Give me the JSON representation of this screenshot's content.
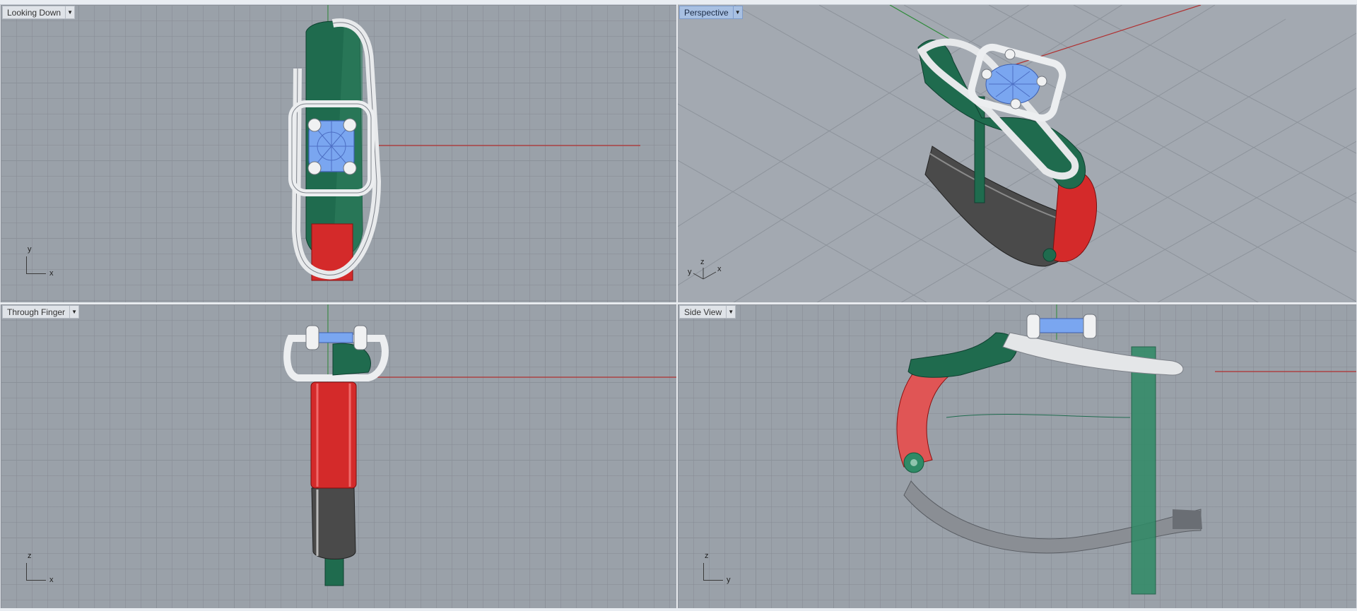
{
  "viewports": {
    "top": {
      "label": "Looking Down",
      "axis_up": "y",
      "axis_right": "x"
    },
    "perspective": {
      "label": "Perspective",
      "axis_labels": [
        "y",
        "z",
        "x"
      ]
    },
    "front": {
      "label": "Through Finger",
      "axis_up": "z",
      "axis_right": "x"
    },
    "side": {
      "label": "Side View",
      "axis_up": "z",
      "axis_right": "y"
    }
  },
  "icons": {
    "dropdown": "dropdown-arrow-icon"
  },
  "colors": {
    "grid_bg": "#9aa1a9",
    "x_axis": "#b03030",
    "y_axis": "#2e8b3a",
    "active_label": "#a8c0e2",
    "ring_green": "#1f6b4e",
    "ring_silver": "#e4e6e8",
    "ring_red": "#d42a2a",
    "ring_dark": "#4a4a4a",
    "gem_blue": "#7aa6f0"
  }
}
